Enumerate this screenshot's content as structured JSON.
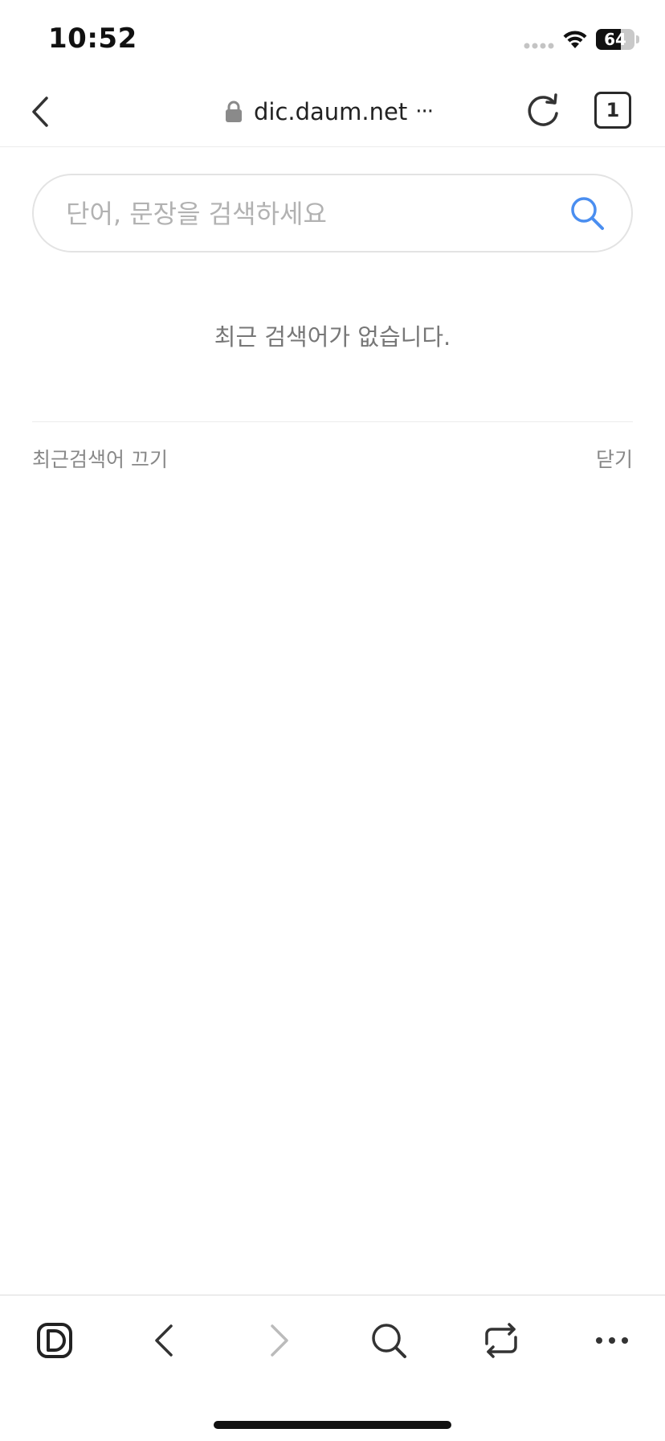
{
  "status_bar": {
    "time": "10:52",
    "battery_level": "64",
    "battery_fraction": 0.64
  },
  "browser": {
    "url": "dic.daum.net",
    "url_more": "···",
    "tab_count": "1"
  },
  "search": {
    "placeholder": "단어, 문장을 검색하세요",
    "value": ""
  },
  "recent": {
    "empty_message": "최근 검색어가 없습니다.",
    "turn_off_label": "최근검색어 끄기",
    "close_label": "닫기"
  },
  "colors": {
    "accent": "#4a8ef0",
    "text_primary": "#222222",
    "text_secondary": "#888888",
    "disabled": "#bbbbbb"
  },
  "icons": {
    "back": "chevron-left-icon",
    "lock": "lock-icon",
    "reload": "reload-icon",
    "search": "search-icon",
    "daum_logo": "daum-logo-icon",
    "forward": "chevron-right-icon",
    "share": "share-icon",
    "more": "more-icon"
  }
}
